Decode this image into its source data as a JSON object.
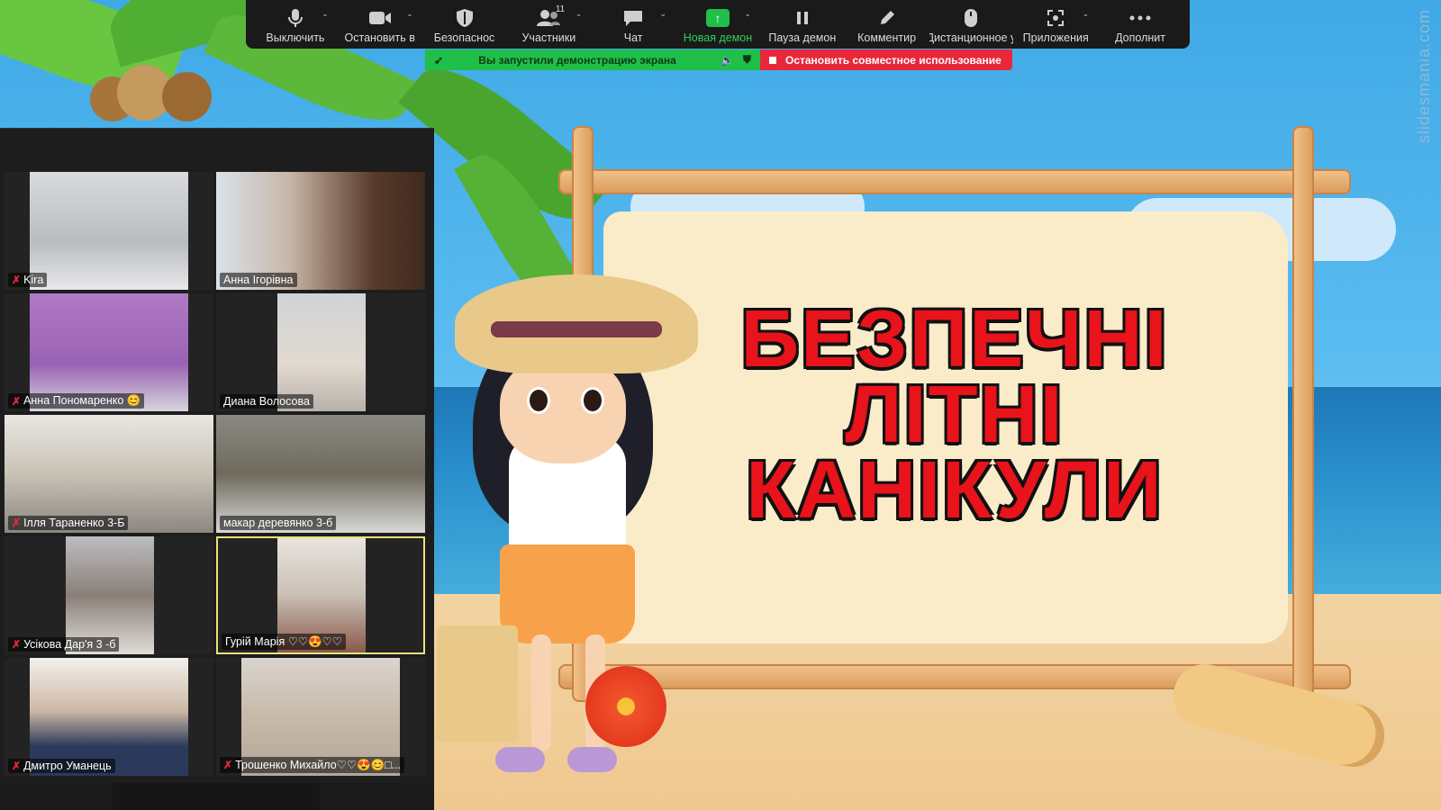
{
  "watermark": "slidesmania.com",
  "toolbar": {
    "items": [
      {
        "label": "Выключить",
        "icon": "microphone-icon"
      },
      {
        "label": "Остановить в",
        "icon": "video-camera-icon"
      },
      {
        "label": "Безопаснос",
        "icon": "shield-icon"
      },
      {
        "label": "Участники",
        "icon": "participants-icon",
        "count": "11"
      },
      {
        "label": "Чат",
        "icon": "chat-icon"
      },
      {
        "label": "Новая демон",
        "icon": "share-screen-icon"
      },
      {
        "label": "Пауза демон",
        "icon": "pause-icon"
      },
      {
        "label": "Комментир",
        "icon": "pencil-icon"
      },
      {
        "label": "Дистанционное у",
        "icon": "mouse-icon"
      },
      {
        "label": "Приложения",
        "icon": "apps-icon"
      },
      {
        "label": "Дополнит",
        "icon": "more-icon"
      }
    ]
  },
  "share_bar": {
    "text": "Вы запустили демонстрацию экрана",
    "stop_label": "Остановить совместное использование"
  },
  "slide": {
    "title_line1": "БЕЗПЕЧНІ",
    "title_line2": "ЛІТНІ",
    "title_line3": "КАНІКУЛИ"
  },
  "participants": [
    {
      "name": "Kira",
      "muted": true
    },
    {
      "name": "Анна Ігорівна",
      "muted": false
    },
    {
      "name": "Анна Пономаренко 😊",
      "muted": true
    },
    {
      "name": "Диана Волосова",
      "muted": false
    },
    {
      "name": "Ілля Тараненко 3-Б",
      "muted": true
    },
    {
      "name": "макар  деревянко 3-б",
      "muted": false
    },
    {
      "name": "Усікова Дар'я 3 -б",
      "muted": true
    },
    {
      "name": "Гурій Марія ♡♡😍♡♡",
      "muted": false,
      "speaking": true
    },
    {
      "name": "Дмитро Уманець",
      "muted": true
    },
    {
      "name": "Трошенко Михайло♡♡😍😊□...",
      "muted": true
    }
  ],
  "colors": {
    "accent_green": "#1fbf4a",
    "stop_red": "#e8283a",
    "title_red": "#e8131b",
    "speaker_border": "#e6e27a"
  }
}
